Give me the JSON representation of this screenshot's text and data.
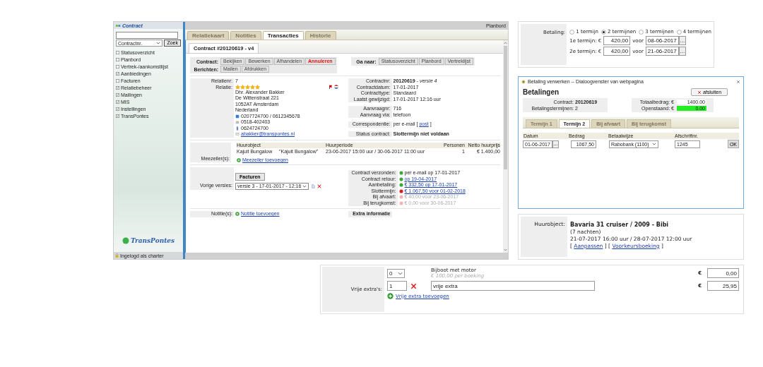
{
  "screenshot": {
    "sidebar": {
      "title": "Contract",
      "select": "Contractnr.",
      "search_button": "Zoek",
      "items": [
        {
          "label": "Statusoverzicht",
          "checked": false
        },
        {
          "label": "Planbord",
          "checked": false
        },
        {
          "label": "Vertrek-/aankomstlijst",
          "checked": false
        },
        {
          "label": "Aanbiedingen",
          "checked": true
        },
        {
          "label": "Facturen",
          "checked": false
        },
        {
          "label": "Relatiebeheer",
          "checked": true
        },
        {
          "label": "Mailingen",
          "checked": true
        },
        {
          "label": "MIS",
          "checked": true
        },
        {
          "label": "Instellingen",
          "checked": true
        },
        {
          "label": "TransPontes",
          "checked": true
        }
      ],
      "logo": "TransPontes",
      "footer": "Ingelogd als charter"
    },
    "top_link": "Planbord",
    "tabs": [
      {
        "label": "Relatiekaart",
        "selected": false
      },
      {
        "label": "Notities",
        "selected": false
      },
      {
        "label": "Transacties",
        "selected": true
      },
      {
        "label": "Historie",
        "selected": false
      }
    ],
    "subtabs": [
      {
        "label": "Contract #20120619 - v4",
        "selected": true
      }
    ],
    "toolbar": {
      "groups": [
        {
          "label": "Contract:",
          "buttons": [
            {
              "label": "Bekijken",
              "danger": false
            },
            {
              "label": "Bewerken",
              "danger": false
            },
            {
              "label": "Afhandelen",
              "danger": false
            },
            {
              "label": "Annuleren",
              "danger": true
            }
          ]
        },
        {
          "label": "Berichten:",
          "buttons": [
            {
              "label": "Mailen",
              "danger": false
            },
            {
              "label": "Afdrukken",
              "danger": false
            }
          ]
        }
      ],
      "goto": {
        "label": "Ga naar:",
        "buttons": [
          "Statusoverzicht",
          "Planbord",
          "Vertreklijst"
        ]
      }
    },
    "relation": {
      "number_label": "Relatienr:",
      "number": "7",
      "label": "Relatie:",
      "stars": 5,
      "address": [
        "Dhr. Alexander Bakker",
        "De Wittenstraat 221",
        "1052AT Amsterdam",
        "Nederland"
      ],
      "contacts": [
        {
          "kind": "phone",
          "text": "0207724700 / 0612345678"
        },
        {
          "kind": "fax",
          "text": "0518-402403"
        },
        {
          "kind": "mobile",
          "text": "0624724700"
        },
        {
          "kind": "email",
          "text": "abakker@transpontes.nl"
        }
      ]
    },
    "contract": {
      "groups": [
        [
          {
            "label": "Contractnr:",
            "parts": [
              {
                "kind": "text",
                "text": "**20120619** - *versie 4*"
              }
            ]
          },
          {
            "label": "Contractdatum:",
            "parts": [
              {
                "kind": "text",
                "text": "17-01-2017"
              }
            ]
          },
          {
            "label": "Contracttype:",
            "parts": [
              {
                "kind": "text",
                "text": "Standaard"
              }
            ]
          },
          {
            "label": "Laatst gewijzigd:",
            "parts": [
              {
                "kind": "text",
                "text": "17-01-2017 12:16 uur"
              }
            ]
          }
        ],
        [
          {
            "label": "Aanvraagnr:",
            "parts": [
              {
                "kind": "text",
                "text": "716"
              }
            ]
          },
          {
            "label": "Aanvraag via:",
            "parts": [
              {
                "kind": "text",
                "text": "telefoon"
              }
            ]
          }
        ],
        [
          {
            "label": "Correspondentie:",
            "parts": [
              {
                "kind": "text",
                "text": "per e-mail ["
              },
              {
                "kind": "link",
                "text": "post"
              },
              {
                "kind": "text",
                "text": "]"
              }
            ]
          }
        ],
        [
          {
            "label": "Status contract:",
            "parts": [
              {
                "kind": "strong",
                "text": "Slottermijn niet voldaan"
              }
            ]
          }
        ]
      ]
    },
    "rental": {
      "columns": [
        "Huurobject",
        "",
        "Huurperiode",
        "Personen",
        "Netto huurprijs"
      ],
      "rows": [
        [
          "Kajuit Bungalow",
          "\"Kajuit Bungalow\"",
          "23-06-2017 15:00 uur / 30-06-2017 11:00 uur",
          "1",
          "€ 1.400,00"
        ]
      ],
      "crew_label": "Meezeiler(s):",
      "crew_link": "Meezeiler toevoegen"
    },
    "versions": {
      "button": "Facturen",
      "label": "Vorige versies:",
      "select": "versie 3 - 17-01-2017 - 12:16"
    },
    "payments": [
      {
        "label": "Contract verzonden:",
        "color": "#3aa83a",
        "link": false,
        "muted": false,
        "text": "per e-mail op 17-01-2017"
      },
      {
        "label": "Contract retour:",
        "color": "#3aa83a",
        "link": true,
        "muted": false,
        "text": "op 19-04-2017"
      },
      {
        "label": "Aanbetaling:",
        "color": "#3aa83a",
        "link": true,
        "muted": false,
        "text": "€ 332,50 op 17-01-2017"
      },
      {
        "label": "Slottermijn:",
        "color": "#d42020",
        "link": true,
        "muted": false,
        "text": "€ 1.067,50 voor 01-02-2018"
      },
      {
        "label": "Bij afvaart:",
        "color": "#f2b4b4",
        "link": false,
        "muted": true,
        "text": "€ 40,00 voor 23-06-2017"
      },
      {
        "label": "Bij terugkomst:",
        "color": "#f2b4b4",
        "link": false,
        "muted": true,
        "text": "€ 0,00 voor 30-06-2017"
      }
    ],
    "notes": {
      "label": "Notitie(s):",
      "link": "Notitie toevoegen"
    },
    "extra_info": {
      "title": "Extra informatie"
    }
  },
  "payment_form": {
    "label": "Betaling:",
    "options": [
      {
        "label": "1 termijn",
        "selected": false
      },
      {
        "label": "2 termijnen",
        "selected": true
      },
      {
        "label": "3 termijnen",
        "selected": false
      },
      {
        "label": "4 termijnen",
        "selected": false
      }
    ],
    "terms": [
      {
        "label": "1e termijn: €",
        "amount": "420,00",
        "before": "voor",
        "date": "08-06-2017",
        "picker": "..."
      },
      {
        "label": "2e termijn: €",
        "amount": "420,00",
        "before": "voor",
        "date": "21-06-2017",
        "picker": "..."
      }
    ]
  },
  "dialog": {
    "title": "Betaling verwerken -- Dialoogvenster van webpagina",
    "heading": "Betalingen",
    "close_button": "afsluiten",
    "info_left": [
      {
        "label": "Contract:",
        "value": "20120619",
        "strong": true
      },
      {
        "label": "Betalingstermijnen:",
        "value": "2",
        "strong": false
      }
    ],
    "info_right": [
      {
        "label": "Totaalbedrag: €",
        "value": "1400.00",
        "highlight": false
      },
      {
        "label": "Openstaand: €",
        "value": "0.00",
        "highlight": true
      }
    ],
    "tabs": [
      {
        "label": "Termijn 1",
        "selected": false
      },
      {
        "label": "Termijn 2",
        "selected": true
      },
      {
        "label": "Bij afvaart",
        "selected": false
      },
      {
        "label": "Bij terugkomst",
        "selected": false
      }
    ],
    "columns": [
      "Datum",
      "Bedrag",
      "Betaalwijze",
      "Afschriftnr."
    ],
    "row": {
      "date": "01-06-2017",
      "picker": "...",
      "amount": "1067,50",
      "method": "Rabobank (1100)",
      "reference": "1245",
      "ok": "OK"
    }
  },
  "rental_object": {
    "label": "Huurobject:",
    "title": "Bavaria 31 cruiser / 2009 - Bibi",
    "lines": [
      "(7 nachten)",
      "21-07-2017 16:00 uur / 28-07-2017 12:00 uur"
    ],
    "actions": [
      {
        "kind": "text",
        "text": "["
      },
      {
        "kind": "link",
        "text": "Aanpassen"
      },
      {
        "kind": "text",
        "text": "] ["
      },
      {
        "kind": "link",
        "text": "Voorkeursboeking"
      },
      {
        "kind": "text",
        "text": "]"
      }
    ]
  },
  "extras": {
    "label": "Vrije extra's:",
    "rows": [
      {
        "kind": "option",
        "qty": "0",
        "name": "Bijboot met motor",
        "note": "€ 100,00 per boeking",
        "currency": "€",
        "price": "0,00"
      },
      {
        "kind": "free",
        "qty": "1",
        "name": "vrije extra",
        "currency": "€",
        "price": "25,95"
      }
    ],
    "add_link": "Vrije extra toevoegen"
  }
}
